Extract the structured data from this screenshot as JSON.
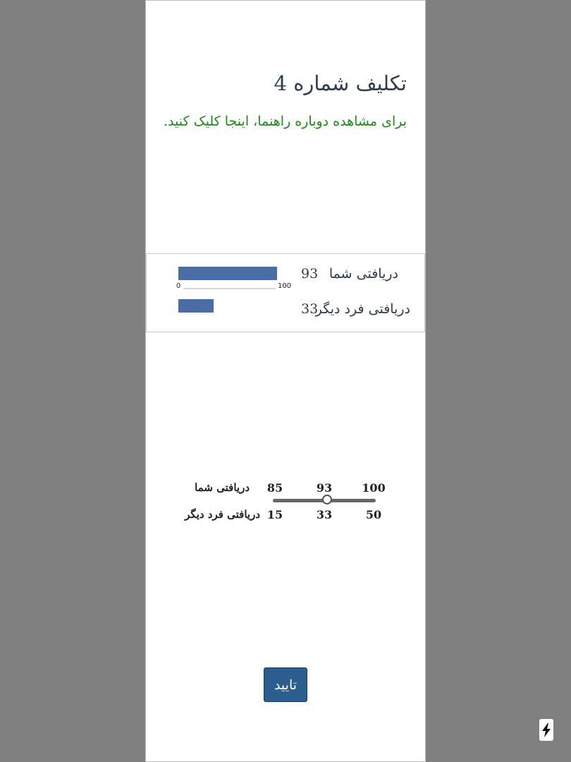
{
  "page": {
    "title": "تکلیف شماره 4",
    "help_link": "برای مشاهده دوباره راهنما، اینجا کلیک کنید."
  },
  "chart_data": {
    "type": "bar",
    "categories": [
      "دریافتی شما",
      "دریافتی فرد دیگر"
    ],
    "values": [
      93,
      33
    ],
    "value_labels": [
      "93",
      "33"
    ],
    "xlim": [
      0,
      100
    ],
    "x_ticks": [
      "0",
      "100"
    ],
    "colors": {
      "bar": "#4a6da6"
    }
  },
  "slider": {
    "label_you": "دریافتی شما",
    "label_other": "دریافتی فرد دیگر",
    "you_min": "85",
    "you_current": "93",
    "you_max": "100",
    "other_min": "15",
    "other_current": "33",
    "other_max": "50",
    "position": 0.53
  },
  "confirm_label": "تایید",
  "icons": {
    "fab": "lightning-icon"
  }
}
